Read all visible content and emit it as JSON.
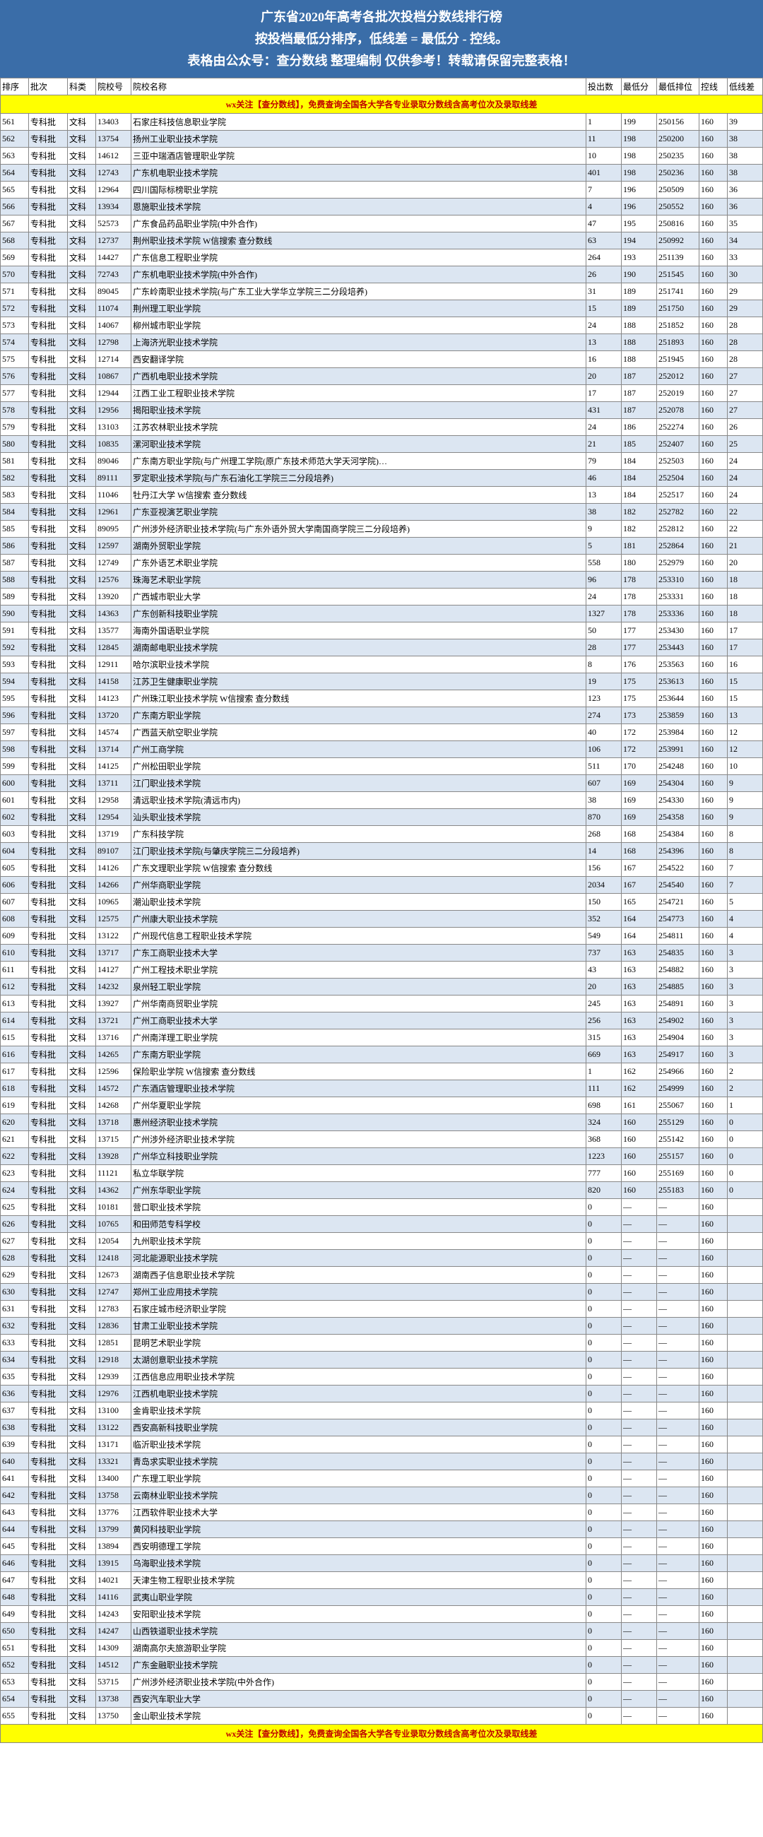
{
  "header": {
    "title1": "广东省2020年高考各批次投档分数线排行榜",
    "title2": "按投档最低分排序，低线差 = 最低分 - 控线。",
    "title3": "表格由公众号：查分数线 整理编制 仅供参考！转载请保留完整表格！"
  },
  "notice": "wx关注【查分数线】，免费查询全国各大学各专业录取分数线含高考位次及录取线差",
  "columns": {
    "rank": "排序",
    "batch": "批次",
    "subject": "科类",
    "code": "院校号",
    "name": "院校名称",
    "count": "投出数",
    "min": "最低分",
    "pos": "最低排位",
    "ctrl": "控线",
    "diff": "低线差"
  },
  "chart_data": {
    "type": "table",
    "title": "广东省2020年高考各批次投档分数线排行榜",
    "columns": [
      "排序",
      "批次",
      "科类",
      "院校号",
      "院校名称",
      "投出数",
      "最低分",
      "最低排位",
      "控线",
      "低线差"
    ],
    "rows": [
      [
        561,
        "专科批",
        "文科",
        "13403",
        "石家庄科技信息职业学院",
        1,
        199,
        250156,
        160,
        39
      ],
      [
        562,
        "专科批",
        "文科",
        "13754",
        "扬州工业职业技术学院",
        11,
        198,
        250200,
        160,
        38
      ],
      [
        563,
        "专科批",
        "文科",
        "14612",
        "三亚中瑞酒店管理职业学院",
        10,
        198,
        250235,
        160,
        38
      ],
      [
        564,
        "专科批",
        "文科",
        "12743",
        "广东机电职业技术学院",
        401,
        198,
        250236,
        160,
        38
      ],
      [
        565,
        "专科批",
        "文科",
        "12964",
        "四川国际标榜职业学院",
        7,
        196,
        250509,
        160,
        36
      ],
      [
        566,
        "专科批",
        "文科",
        "13934",
        "恩施职业技术学院",
        4,
        196,
        250552,
        160,
        36
      ],
      [
        567,
        "专科批",
        "文科",
        "52573",
        "广东食品药品职业学院(中外合作)",
        47,
        195,
        250816,
        160,
        35
      ],
      [
        568,
        "专科批",
        "文科",
        "12737",
        "荆州职业技术学院 W信搜索 查分数线",
        63,
        194,
        250992,
        160,
        34
      ],
      [
        569,
        "专科批",
        "文科",
        "14427",
        "广东信息工程职业学院",
        264,
        193,
        251139,
        160,
        33
      ],
      [
        570,
        "专科批",
        "文科",
        "72743",
        "广东机电职业技术学院(中外合作)",
        26,
        190,
        251545,
        160,
        30
      ],
      [
        571,
        "专科批",
        "文科",
        "89045",
        "广东岭南职业技术学院(与广东工业大学华立学院三二分段培养)",
        31,
        189,
        251741,
        160,
        29
      ],
      [
        572,
        "专科批",
        "文科",
        "11074",
        "荆州理工职业学院",
        15,
        189,
        251750,
        160,
        29
      ],
      [
        573,
        "专科批",
        "文科",
        "14067",
        "柳州城市职业学院",
        24,
        188,
        251852,
        160,
        28
      ],
      [
        574,
        "专科批",
        "文科",
        "12798",
        "上海济光职业技术学院",
        13,
        188,
        251893,
        160,
        28
      ],
      [
        575,
        "专科批",
        "文科",
        "12714",
        "西安翻译学院",
        16,
        188,
        251945,
        160,
        28
      ],
      [
        576,
        "专科批",
        "文科",
        "10867",
        "广西机电职业技术学院",
        20,
        187,
        252012,
        160,
        27
      ],
      [
        577,
        "专科批",
        "文科",
        "12944",
        "江西工业工程职业技术学院",
        17,
        187,
        252019,
        160,
        27
      ],
      [
        578,
        "专科批",
        "文科",
        "12956",
        "揭阳职业技术学院",
        431,
        187,
        252078,
        160,
        27
      ],
      [
        579,
        "专科批",
        "文科",
        "13103",
        "江苏农林职业技术学院",
        24,
        186,
        252274,
        160,
        26
      ],
      [
        580,
        "专科批",
        "文科",
        "10835",
        "漯河职业技术学院",
        21,
        185,
        252407,
        160,
        25
      ],
      [
        581,
        "专科批",
        "文科",
        "89046",
        "广东南方职业学院(与广州理工学院(原广东技术师范大学天河学院)…",
        79,
        184,
        252503,
        160,
        24
      ],
      [
        582,
        "专科批",
        "文科",
        "89111",
        "罗定职业技术学院(与广东石油化工学院三二分段培养)",
        46,
        184,
        252504,
        160,
        24
      ],
      [
        583,
        "专科批",
        "文科",
        "11046",
        "牡丹江大学 W信搜索 查分数线",
        13,
        184,
        252517,
        160,
        24
      ],
      [
        584,
        "专科批",
        "文科",
        "12961",
        "广东亚视演艺职业学院",
        38,
        182,
        252782,
        160,
        22
      ],
      [
        585,
        "专科批",
        "文科",
        "89095",
        "广州涉外经济职业技术学院(与广东外语外贸大学南国商学院三二分段培养)",
        9,
        182,
        252812,
        160,
        22
      ],
      [
        586,
        "专科批",
        "文科",
        "12597",
        "湖南外贸职业学院",
        5,
        181,
        252864,
        160,
        21
      ],
      [
        587,
        "专科批",
        "文科",
        "12749",
        "广东外语艺术职业学院",
        558,
        180,
        252979,
        160,
        20
      ],
      [
        588,
        "专科批",
        "文科",
        "12576",
        "珠海艺术职业学院",
        96,
        178,
        253310,
        160,
        18
      ],
      [
        589,
        "专科批",
        "文科",
        "13920",
        "广西城市职业大学",
        24,
        178,
        253331,
        160,
        18
      ],
      [
        590,
        "专科批",
        "文科",
        "14363",
        "广东创新科技职业学院",
        1327,
        178,
        253336,
        160,
        18
      ],
      [
        591,
        "专科批",
        "文科",
        "13577",
        "海南外国语职业学院",
        50,
        177,
        253430,
        160,
        17
      ],
      [
        592,
        "专科批",
        "文科",
        "12845",
        "湖南邮电职业技术学院",
        28,
        177,
        253443,
        160,
        17
      ],
      [
        593,
        "专科批",
        "文科",
        "12911",
        "哈尔滨职业技术学院",
        8,
        176,
        253563,
        160,
        16
      ],
      [
        594,
        "专科批",
        "文科",
        "14158",
        "江苏卫生健康职业学院",
        19,
        175,
        253613,
        160,
        15
      ],
      [
        595,
        "专科批",
        "文科",
        "14123",
        "广州珠江职业技术学院 W信搜索 查分数线",
        123,
        175,
        253644,
        160,
        15
      ],
      [
        596,
        "专科批",
        "文科",
        "13720",
        "广东南方职业学院",
        274,
        173,
        253859,
        160,
        13
      ],
      [
        597,
        "专科批",
        "文科",
        "14574",
        "广西蓝天航空职业学院",
        40,
        172,
        253984,
        160,
        12
      ],
      [
        598,
        "专科批",
        "文科",
        "13714",
        "广州工商学院",
        106,
        172,
        253991,
        160,
        12
      ],
      [
        599,
        "专科批",
        "文科",
        "14125",
        "广州松田职业学院",
        511,
        170,
        254248,
        160,
        10
      ],
      [
        600,
        "专科批",
        "文科",
        "13711",
        "江门职业技术学院",
        607,
        169,
        254304,
        160,
        9
      ],
      [
        601,
        "专科批",
        "文科",
        "12958",
        "清远职业技术学院(清远市内)",
        38,
        169,
        254330,
        160,
        9
      ],
      [
        602,
        "专科批",
        "文科",
        "12954",
        "汕头职业技术学院",
        870,
        169,
        254358,
        160,
        9
      ],
      [
        603,
        "专科批",
        "文科",
        "13719",
        "广东科技学院",
        268,
        168,
        254384,
        160,
        8
      ],
      [
        604,
        "专科批",
        "文科",
        "89107",
        "江门职业技术学院(与肇庆学院三二分段培养)",
        14,
        168,
        254396,
        160,
        8
      ],
      [
        605,
        "专科批",
        "文科",
        "14126",
        "广东文理职业学院 W信搜索 查分数线",
        156,
        167,
        254522,
        160,
        7
      ],
      [
        606,
        "专科批",
        "文科",
        "14266",
        "广州华商职业学院",
        2034,
        167,
        254540,
        160,
        7
      ],
      [
        607,
        "专科批",
        "文科",
        "10965",
        "潮汕职业技术学院",
        150,
        165,
        254721,
        160,
        5
      ],
      [
        608,
        "专科批",
        "文科",
        "12575",
        "广州康大职业技术学院",
        352,
        164,
        254773,
        160,
        4
      ],
      [
        609,
        "专科批",
        "文科",
        "13122",
        "广州现代信息工程职业技术学院",
        549,
        164,
        254811,
        160,
        4
      ],
      [
        610,
        "专科批",
        "文科",
        "13717",
        "广东工商职业技术大学",
        737,
        163,
        254835,
        160,
        3
      ],
      [
        611,
        "专科批",
        "文科",
        "14127",
        "广州工程技术职业学院",
        43,
        163,
        254882,
        160,
        3
      ],
      [
        612,
        "专科批",
        "文科",
        "14232",
        "泉州轻工职业学院",
        20,
        163,
        254885,
        160,
        3
      ],
      [
        613,
        "专科批",
        "文科",
        "13927",
        "广州华南商贸职业学院",
        245,
        163,
        254891,
        160,
        3
      ],
      [
        614,
        "专科批",
        "文科",
        "13721",
        "广州工商职业技术大学",
        256,
        163,
        254902,
        160,
        3
      ],
      [
        615,
        "专科批",
        "文科",
        "13716",
        "广州南洋理工职业学院",
        315,
        163,
        254904,
        160,
        3
      ],
      [
        616,
        "专科批",
        "文科",
        "14265",
        "广东南方职业学院",
        669,
        163,
        254917,
        160,
        3
      ],
      [
        617,
        "专科批",
        "文科",
        "12596",
        "保险职业学院 W信搜索 查分数线",
        1,
        162,
        254966,
        160,
        2
      ],
      [
        618,
        "专科批",
        "文科",
        "14572",
        "广东酒店管理职业技术学院",
        111,
        162,
        254999,
        160,
        2
      ],
      [
        619,
        "专科批",
        "文科",
        "14268",
        "广州华夏职业学院",
        698,
        161,
        255067,
        160,
        1
      ],
      [
        620,
        "专科批",
        "文科",
        "13718",
        "惠州经济职业技术学院",
        324,
        160,
        255129,
        160,
        0
      ],
      [
        621,
        "专科批",
        "文科",
        "13715",
        "广州涉外经济职业技术学院",
        368,
        160,
        255142,
        160,
        0
      ],
      [
        622,
        "专科批",
        "文科",
        "13928",
        "广州华立科技职业学院",
        1223,
        160,
        255157,
        160,
        0
      ],
      [
        623,
        "专科批",
        "文科",
        "11121",
        "私立华联学院",
        777,
        160,
        255169,
        160,
        0
      ],
      [
        624,
        "专科批",
        "文科",
        "14362",
        "广州东华职业学院",
        820,
        160,
        255183,
        160,
        0
      ],
      [
        625,
        "专科批",
        "文科",
        "10181",
        "营口职业技术学院",
        0,
        "—",
        "—",
        160,
        ""
      ],
      [
        626,
        "专科批",
        "文科",
        "10765",
        "和田师范专科学校",
        0,
        "—",
        "—",
        160,
        ""
      ],
      [
        627,
        "专科批",
        "文科",
        "12054",
        "九州职业技术学院",
        0,
        "—",
        "—",
        160,
        ""
      ],
      [
        628,
        "专科批",
        "文科",
        "12418",
        "河北能源职业技术学院",
        0,
        "—",
        "—",
        160,
        ""
      ],
      [
        629,
        "专科批",
        "文科",
        "12673",
        "湖南西子信息职业技术学院",
        0,
        "—",
        "—",
        160,
        ""
      ],
      [
        630,
        "专科批",
        "文科",
        "12747",
        "郑州工业应用技术学院",
        0,
        "—",
        "—",
        160,
        ""
      ],
      [
        631,
        "专科批",
        "文科",
        "12783",
        "石家庄城市经济职业学院",
        0,
        "—",
        "—",
        160,
        ""
      ],
      [
        632,
        "专科批",
        "文科",
        "12836",
        "甘肃工业职业技术学院",
        0,
        "—",
        "—",
        160,
        ""
      ],
      [
        633,
        "专科批",
        "文科",
        "12851",
        "昆明艺术职业学院",
        0,
        "—",
        "—",
        160,
        ""
      ],
      [
        634,
        "专科批",
        "文科",
        "12918",
        "太湖创意职业技术学院",
        0,
        "—",
        "—",
        160,
        ""
      ],
      [
        635,
        "专科批",
        "文科",
        "12939",
        "江西信息应用职业技术学院",
        0,
        "—",
        "—",
        160,
        ""
      ],
      [
        636,
        "专科批",
        "文科",
        "12976",
        "江西机电职业技术学院",
        0,
        "—",
        "—",
        160,
        ""
      ],
      [
        637,
        "专科批",
        "文科",
        "13100",
        "金肯职业技术学院",
        0,
        "—",
        "—",
        160,
        ""
      ],
      [
        638,
        "专科批",
        "文科",
        "13122",
        "西安高新科技职业学院",
        0,
        "—",
        "—",
        160,
        ""
      ],
      [
        639,
        "专科批",
        "文科",
        "13171",
        "临沂职业技术学院",
        0,
        "—",
        "—",
        160,
        ""
      ],
      [
        640,
        "专科批",
        "文科",
        "13321",
        "青岛求实职业技术学院",
        0,
        "—",
        "—",
        160,
        ""
      ],
      [
        641,
        "专科批",
        "文科",
        "13400",
        "广东理工职业学院",
        0,
        "—",
        "—",
        160,
        ""
      ],
      [
        642,
        "专科批",
        "文科",
        "13758",
        "云南林业职业技术学院",
        0,
        "—",
        "—",
        160,
        ""
      ],
      [
        643,
        "专科批",
        "文科",
        "13776",
        "江西软件职业技术大学",
        0,
        "—",
        "—",
        160,
        ""
      ],
      [
        644,
        "专科批",
        "文科",
        "13799",
        "黄冈科技职业学院",
        0,
        "—",
        "—",
        160,
        ""
      ],
      [
        645,
        "专科批",
        "文科",
        "13894",
        "西安明德理工学院",
        0,
        "—",
        "—",
        160,
        ""
      ],
      [
        646,
        "专科批",
        "文科",
        "13915",
        "乌海职业技术学院",
        0,
        "—",
        "—",
        160,
        ""
      ],
      [
        647,
        "专科批",
        "文科",
        "14021",
        "天津生物工程职业技术学院",
        0,
        "—",
        "—",
        160,
        ""
      ],
      [
        648,
        "专科批",
        "文科",
        "14116",
        "武夷山职业学院",
        0,
        "—",
        "—",
        160,
        ""
      ],
      [
        649,
        "专科批",
        "文科",
        "14243",
        "安阳职业技术学院",
        0,
        "—",
        "—",
        160,
        ""
      ],
      [
        650,
        "专科批",
        "文科",
        "14247",
        "山西铁道职业技术学院",
        0,
        "—",
        "—",
        160,
        ""
      ],
      [
        651,
        "专科批",
        "文科",
        "14309",
        "湖南高尔夫旅游职业学院",
        0,
        "—",
        "—",
        160,
        ""
      ],
      [
        652,
        "专科批",
        "文科",
        "14512",
        "广东金融职业技术学院",
        0,
        "—",
        "—",
        160,
        ""
      ],
      [
        653,
        "专科批",
        "文科",
        "53715",
        "广州涉外经济职业技术学院(中外合作)",
        0,
        "—",
        "—",
        160,
        ""
      ],
      [
        654,
        "专科批",
        "文科",
        "13738",
        "西安汽车职业大学",
        0,
        "—",
        "—",
        160,
        ""
      ],
      [
        655,
        "专科批",
        "文科",
        "13750",
        "金山职业技术学院",
        0,
        "—",
        "—",
        160,
        ""
      ]
    ]
  }
}
